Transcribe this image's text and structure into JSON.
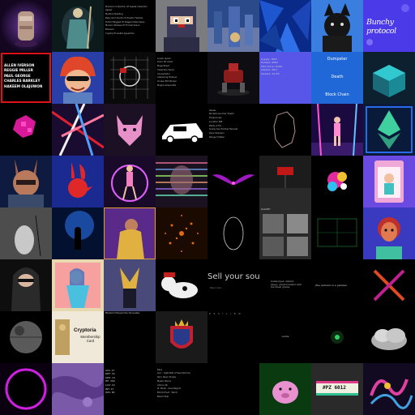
{
  "gallery": {
    "tiles": [
      {
        "name": "Robot Tea Kettle Art"
      },
      {
        "name": "Wizard Warrior Art"
      },
      {
        "name": "Text Listing Card",
        "lines": [
          "Premium Collection Of Assets Collection",
          "Jigsaw",
          "Mystery Building",
          "Baby Grim Earth of Chaotic Flexible",
          "Oxford Biggest Of Dagwud Reindeers",
          "Maroon Statues Of Formal Grace",
          "Blossom",
          "CryptoJ Of wallet Apparition"
        ]
      },
      {
        "name": "Pixel Ninja"
      },
      {
        "name": "Robot City Painting"
      },
      {
        "name": "Blue Abstract Shards"
      },
      {
        "name": "Black Dog Portrait"
      },
      {
        "name": "Bunchy Protocol Card",
        "text": "Bunchy protocol"
      },
      {
        "name": "Names Card",
        "lines": [
          "ALLEN IVERSON",
          "REGGIE MILLER",
          "PAUL GEORGE",
          "CHARLES BARKLEY",
          "HAKEEM OLAJUWON"
        ]
      },
      {
        "name": "Red Hair Elf Cartoon"
      },
      {
        "name": "Grid Network Logo"
      },
      {
        "name": "Text Listing Black",
        "lines": [
          "Lorem Ipsum",
          "Dolor Sit Amet",
          "Magnificent",
          "Collection Items",
          "Consectetur",
          "Adipiscing Tempus",
          "Ornare Elit Tempor",
          "Magna Aliqua Nisi"
        ]
      },
      {
        "name": "Red Mech Robot"
      },
      {
        "name": "Stats Card Purple",
        "lines": [
          "Supply: 7843",
          "Holders: 4567",
          "Floor Price: 0.043",
          "Volume: 18.2",
          "Owners: 12.4%"
        ]
      },
      {
        "name": "Dumpster Death Card",
        "lines": [
          "Dumpster",
          "Death",
          "Block Chain"
        ]
      },
      {
        "name": "Teal Chest Art"
      },
      {
        "name": "Magenta Floral Glitch"
      },
      {
        "name": "Neon Lines Abstract"
      },
      {
        "name": "Pink Wolf Logo"
      },
      {
        "name": "Race Car Logo"
      },
      {
        "name": "Properties List",
        "lines": [
          "Values",
          "Rocket Launcher Shield",
          "Frequencies",
          "Location NW",
          "Rarity 4.5%",
          "Scarecrow Zombie Harvest",
          "Zone Shinjuku",
          "Range 5 Meter"
        ]
      },
      {
        "name": "Line Outline Map"
      },
      {
        "name": "Neon Dancer Stage"
      },
      {
        "name": "Ethereum Logo Glass"
      },
      {
        "name": "Armored Rabbit Portrait"
      },
      {
        "name": "Playboy Rabbit Logo"
      },
      {
        "name": "Neon Ring Dancer"
      },
      {
        "name": "Glitch Portrait"
      },
      {
        "name": "Neon Wings"
      },
      {
        "name": "Red Logo Dark Room"
      },
      {
        "name": "Colorful Glitch Flower"
      },
      {
        "name": "Pink Toy Box Card"
      },
      {
        "name": "White Figure Mist"
      },
      {
        "name": "Blue Figure Ocean"
      },
      {
        "name": "Purple Comic Woman"
      },
      {
        "name": "Orange Particle Burst"
      },
      {
        "name": "Thin Ring Outline"
      },
      {
        "name": "Gallery Collage",
        "text": "GALLERY"
      },
      {
        "name": "Green Grid Outline"
      },
      {
        "name": "Tribal Warrior Portrait"
      },
      {
        "name": "Hooded Ninja Portrait"
      },
      {
        "name": "Anime Girl Framed"
      },
      {
        "name": "Fox Mask Character"
      },
      {
        "name": "Cartoon Cow Hat"
      },
      {
        "name": "Sell Your Soul Card",
        "text": "Sell your soul",
        "subtext": "Begin here"
      },
      {
        "name": "Philosophical Paragraph",
        "text": "Submerged, distant, happy, graph bundled with the finest grains."
      },
      {
        "name": "Sentence Card",
        "text": "Zhe Autumn is a parallel"
      },
      {
        "name": "Neon X Glow"
      },
      {
        "name": "Death Star Sphere"
      },
      {
        "name": "Cryptoria Membership Card",
        "title": "Cryptoria",
        "subtitle": "Membership Card"
      },
      {
        "name": "Black Empty Card Title",
        "caption": "Phantom Phoenix the Honorable"
      },
      {
        "name": "Crowned Shield Emblem"
      },
      {
        "name": "Spaced Label Card",
        "text": "R E S I L I E N"
      },
      {
        "name": "Small Center Label",
        "text": "Landia"
      },
      {
        "name": "Green Orb Particles"
      },
      {
        "name": "Silver Cloud Sculpture"
      },
      {
        "name": "Neon Ring Portal"
      },
      {
        "name": "Purple Texture Map"
      },
      {
        "name": "Stats List Dark",
        "lines": [
          "ATK: 27",
          "DEF: 39",
          "SPD: 14",
          "HP: 360",
          "LCK: 19",
          "INT: 27",
          "WIS: 82"
        ]
      },
      {
        "name": "Traits List",
        "lines": [
          "Rare",
          "Gun : Light Bolt of Sword/Armor",
          "Skin: Neon Purple",
          "Mystic Pierce",
          "Ammo 46",
          "#: Pandi - Goa Megrim",
          "Bomb Proof - Pandi",
          "Beard Ship"
        ]
      },
      {
        "name": "Black Empty Tile"
      },
      {
        "name": "Pink Pig Blob"
      },
      {
        "name": "Retro Plate Card",
        "text": "#PZ 6012"
      },
      {
        "name": "Abstract Fluid Colors"
      }
    ]
  }
}
